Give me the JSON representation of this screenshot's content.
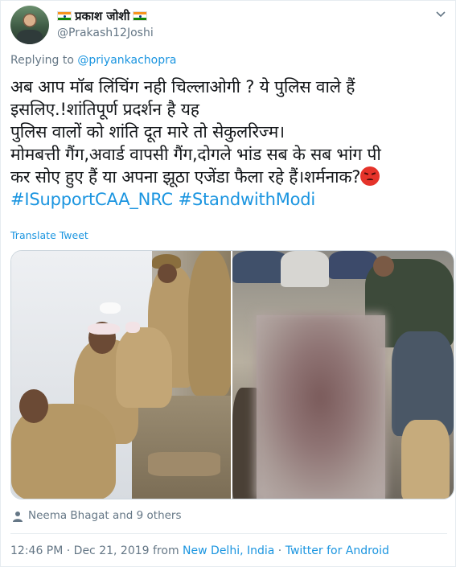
{
  "author": {
    "display_name": "प्रकाश जोशी",
    "handle": "@Prakash12Joshi",
    "flag_icon": "india-flag-icon"
  },
  "reply": {
    "prefix": "Replying to",
    "target": "@priyankachopra"
  },
  "tweet": {
    "lines": [
      "अब आप मॉब लिंचिंग नही चिल्लाओगी ? ये पुलिस वाले हैं",
      "इसलिए.!शांतिपूर्ण प्रदर्शन है यह",
      "पुलिस वालों को शांति दूत मारे तो सेकुलरिज्म।",
      "मोमबत्ती गैंग,अवार्ड वापसी गैंग,दोगले भांड सब के सब भांग पी",
      "कर सोए हुए हैं या अपना झूठा एजेंडा फैला रहे हैं।शर्मनाक?"
    ],
    "hashtags": "#ISupportCAA_NRC #StandwithModi",
    "emoji": "angry-face-icon"
  },
  "translate_label": "Translate Tweet",
  "likes_text": "Neema Bhagat and 9 others",
  "meta": {
    "time_date": "12:46 PM · Dec 21, 2019 from ",
    "location": "New Delhi, India",
    "separator": " · ",
    "client": "Twitter for Android"
  },
  "colors": {
    "link": "#1b95e0",
    "secondary_text": "#657786",
    "primary_text": "#14171a"
  }
}
